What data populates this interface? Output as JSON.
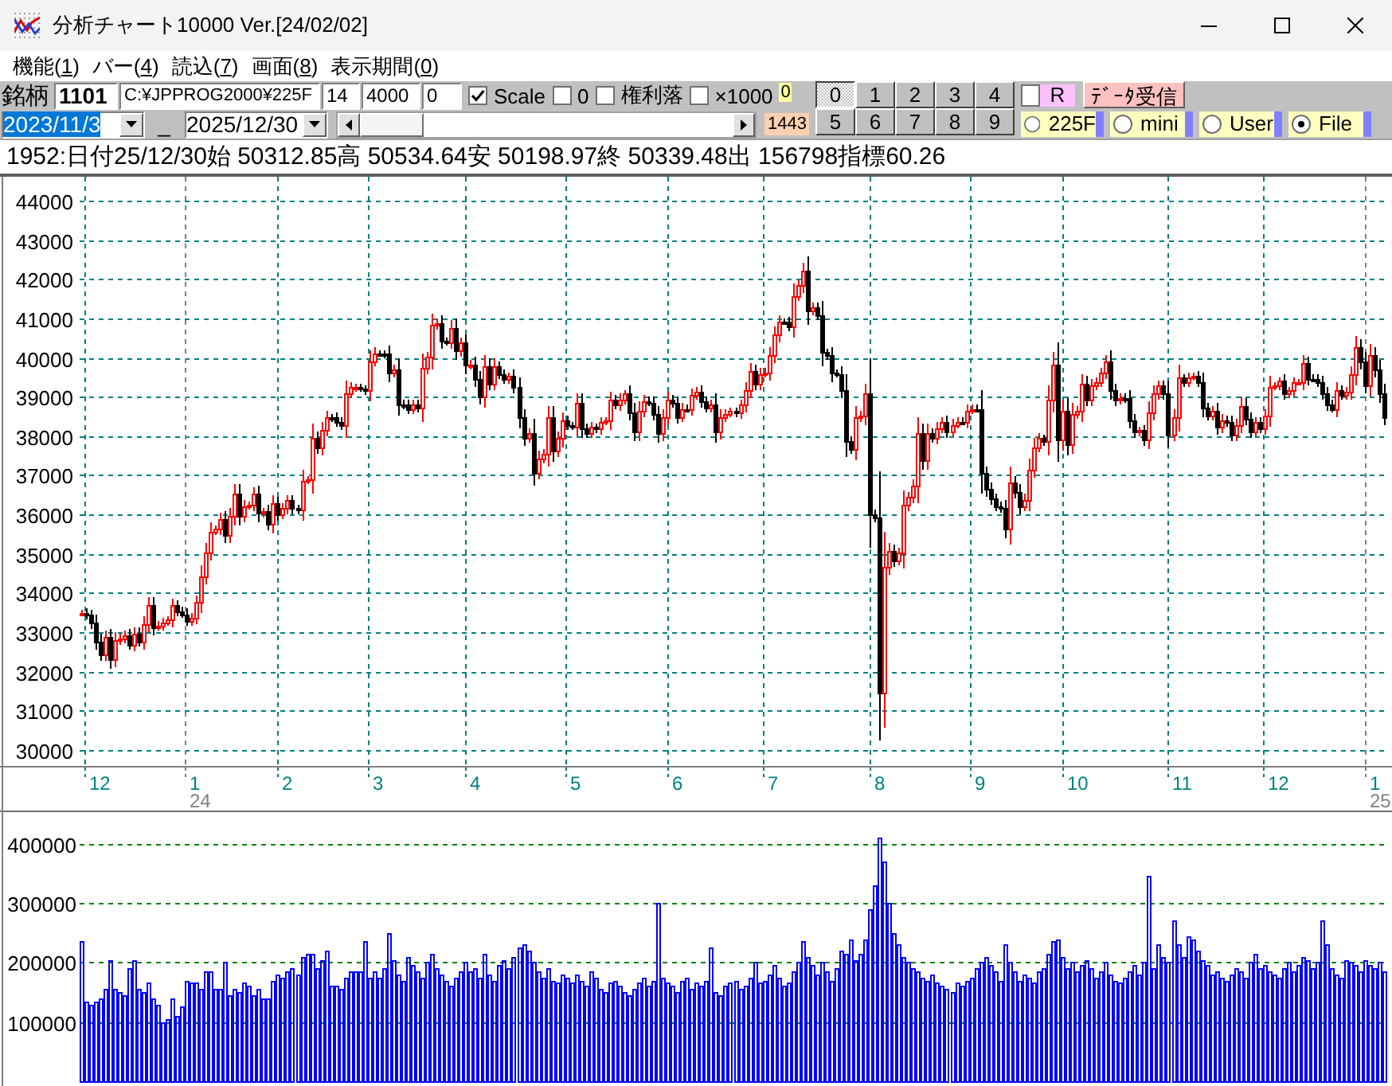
{
  "window": {
    "title": "分析チャート10000 Ver.[24/02/02]"
  },
  "menu": [
    {
      "before": "機能(",
      "key": "1",
      "after": ")"
    },
    {
      "before": "バー(",
      "key": "4",
      "after": ")"
    },
    {
      "before": "読込(",
      "key": "7",
      "after": ")"
    },
    {
      "before": "画面(",
      "key": "8",
      "after": ")"
    },
    {
      "before": "表示期間(",
      "key": "0",
      "after": ")"
    }
  ],
  "toolbar": {
    "symbol_label": "銘柄",
    "symbol": "1101",
    "path": "C:¥JPPROG2000¥225F",
    "fields": [
      "14",
      "4000",
      "0"
    ],
    "checkboxes": [
      {
        "label": "Scale",
        "checked": true
      },
      {
        "label": "0",
        "checked": false
      },
      {
        "label": "権利落",
        "checked": false
      },
      {
        "label": "×1000",
        "checked": false
      }
    ],
    "indicator_1": "0",
    "start_date": {
      "value": "2023/11/3",
      "highlighted": true
    },
    "separator": "_",
    "end_date": {
      "value": "2025/12/30",
      "highlighted": false
    },
    "indicator_2": "1443",
    "digit_buttons": [
      {
        "label": "0",
        "selected": true
      },
      {
        "label": "1",
        "selected": false
      },
      {
        "label": "2",
        "selected": false
      },
      {
        "label": "3",
        "selected": false
      },
      {
        "label": "4",
        "selected": false
      },
      {
        "label": "5",
        "selected": false
      },
      {
        "label": "6",
        "selected": false
      },
      {
        "label": "7",
        "selected": false
      },
      {
        "label": "8",
        "selected": false
      },
      {
        "label": "9",
        "selected": false
      }
    ],
    "r_checkbox": {
      "label": "R",
      "checked": false
    },
    "receive_button": "ﾃﾞｰﾀ受信",
    "sources": [
      {
        "label": "225F",
        "selected": false
      },
      {
        "label": "mini",
        "selected": false
      },
      {
        "label": "User",
        "selected": false
      },
      {
        "label": "File",
        "selected": true
      }
    ]
  },
  "info_line": "1952:日付25/12/30始 50312.85高 50534.64安 50198.97終 50339.48出 156798指標60.26",
  "price_chart": {
    "y_labels": [
      "44000",
      "43000",
      "42000",
      "41000",
      "40000",
      "39000",
      "38000",
      "37000",
      "36000",
      "35000",
      "34000",
      "33000",
      "32000",
      "31000",
      "30000"
    ],
    "month_labels": [
      {
        "label": "12"
      },
      {
        "label": "1",
        "year": "24"
      },
      {
        "label": "2"
      },
      {
        "label": "3"
      },
      {
        "label": "4"
      },
      {
        "label": "5"
      },
      {
        "label": "6"
      },
      {
        "label": "7"
      },
      {
        "label": "8"
      },
      {
        "label": "9"
      },
      {
        "label": "10"
      },
      {
        "label": "11"
      },
      {
        "label": "12"
      },
      {
        "label": "1",
        "year": "25"
      }
    ]
  },
  "volume_chart": {
    "chart_data": {
      "type": "bar",
      "ylim": [
        0,
        456000
      ],
      "yticks": [
        100000,
        200000,
        300000,
        400000
      ],
      "grid": true,
      "values": [
        235000,
        135000,
        130000,
        135000,
        140000,
        155000,
        205000,
        155000,
        150000,
        145000,
        190000,
        205000,
        155000,
        150000,
        165000,
        140000,
        130000,
        100000,
        105000,
        140000,
        110000,
        125000,
        170000,
        165000,
        165000,
        155000,
        185000,
        185000,
        155000,
        155000,
        200000,
        145000,
        155000,
        150000,
        165000,
        160000,
        145000,
        155000,
        140000,
        140000,
        170000,
        180000,
        175000,
        185000,
        190000,
        180000,
        210000,
        215000,
        215000,
        190000,
        205000,
        220000,
        160000,
        160000,
        155000,
        175000,
        185000,
        185000,
        185000,
        235000,
        175000,
        185000,
        175000,
        190000,
        250000,
        205000,
        180000,
        170000,
        210000,
        195000,
        185000,
        175000,
        200000,
        215000,
        190000,
        180000,
        170000,
        160000,
        175000,
        185000,
        200000,
        185000,
        190000,
        175000,
        215000,
        180000,
        170000,
        195000,
        205000,
        190000,
        210000,
        225000,
        230000,
        220000,
        200000,
        185000,
        175000,
        190000,
        170000,
        165000,
        180000,
        175000,
        165000,
        180000,
        170000,
        160000,
        185000,
        175000,
        155000,
        150000,
        165000,
        170000,
        160000,
        150000,
        145000,
        155000,
        165000,
        175000,
        160000,
        170000,
        300000,
        175000,
        165000,
        160000,
        150000,
        170000,
        175000,
        155000,
        165000,
        160000,
        170000,
        225000,
        150000,
        145000,
        160000,
        165000,
        170000,
        155000,
        160000,
        175000,
        200000,
        165000,
        170000,
        180000,
        195000,
        175000,
        160000,
        165000,
        185000,
        200000,
        235000,
        210000,
        195000,
        180000,
        200000,
        185000,
        170000,
        190000,
        220000,
        215000,
        240000,
        205000,
        215000,
        240000,
        290000,
        330000,
        410000,
        370000,
        300000,
        250000,
        230000,
        210000,
        200000,
        190000,
        185000,
        175000,
        170000,
        180000,
        165000,
        160000,
        155000,
        150000,
        165000,
        160000,
        170000,
        175000,
        190000,
        200000,
        210000,
        195000,
        185000,
        170000,
        230000,
        200000,
        185000,
        170000,
        180000,
        175000,
        165000,
        185000,
        190000,
        215000,
        235000,
        240000,
        210000,
        190000,
        200000,
        185000,
        195000,
        205000,
        190000,
        175000,
        185000,
        200000,
        180000,
        170000,
        165000,
        175000,
        185000,
        195000,
        180000,
        200000,
        345000,
        190000,
        230000,
        210000,
        200000,
        270000,
        230000,
        210000,
        245000,
        240000,
        220000,
        205000,
        195000,
        180000,
        185000,
        175000,
        170000,
        180000,
        190000,
        185000,
        175000,
        200000,
        215000,
        190000,
        195000,
        185000,
        180000,
        175000,
        190000,
        200000,
        185000,
        195000,
        210000,
        205000,
        190000,
        200000,
        270000,
        230000,
        190000,
        180000,
        175000,
        205000,
        200000,
        195000,
        185000,
        205000,
        195000,
        190000,
        200000,
        185000
      ]
    }
  }
}
